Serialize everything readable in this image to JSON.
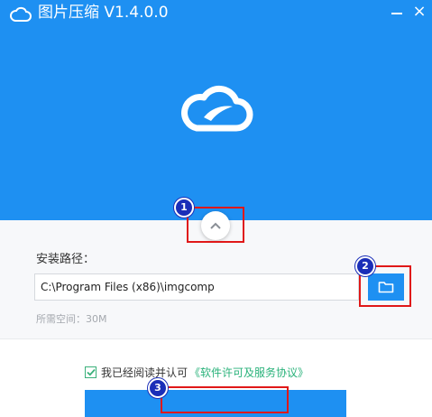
{
  "window": {
    "title": "图片压缩 V1.4.0.0",
    "icons": {
      "app": "cloud-icon",
      "minimize": "minimize-icon",
      "close": "close-icon",
      "logo": "cloud-logo-icon",
      "collapse": "chevron-up-icon",
      "browse": "folder-icon",
      "checkbox": "check-icon"
    },
    "close_glyph": "×",
    "colors": {
      "primary": "#1e90f2",
      "link": "#29b27a",
      "annotation": "#e01818",
      "badge": "#1a2eb8"
    }
  },
  "install": {
    "path_label": "安装路径：",
    "path_value": "C:\\Program Files (x86)\\imgcomp",
    "space_required": "所需空间：30M"
  },
  "agreement": {
    "checked": true,
    "text": "我已经阅读并认可",
    "link": "《软件许可及服务协议》"
  },
  "annotations": {
    "badge1": "1",
    "badge2": "2",
    "badge3": "3"
  }
}
